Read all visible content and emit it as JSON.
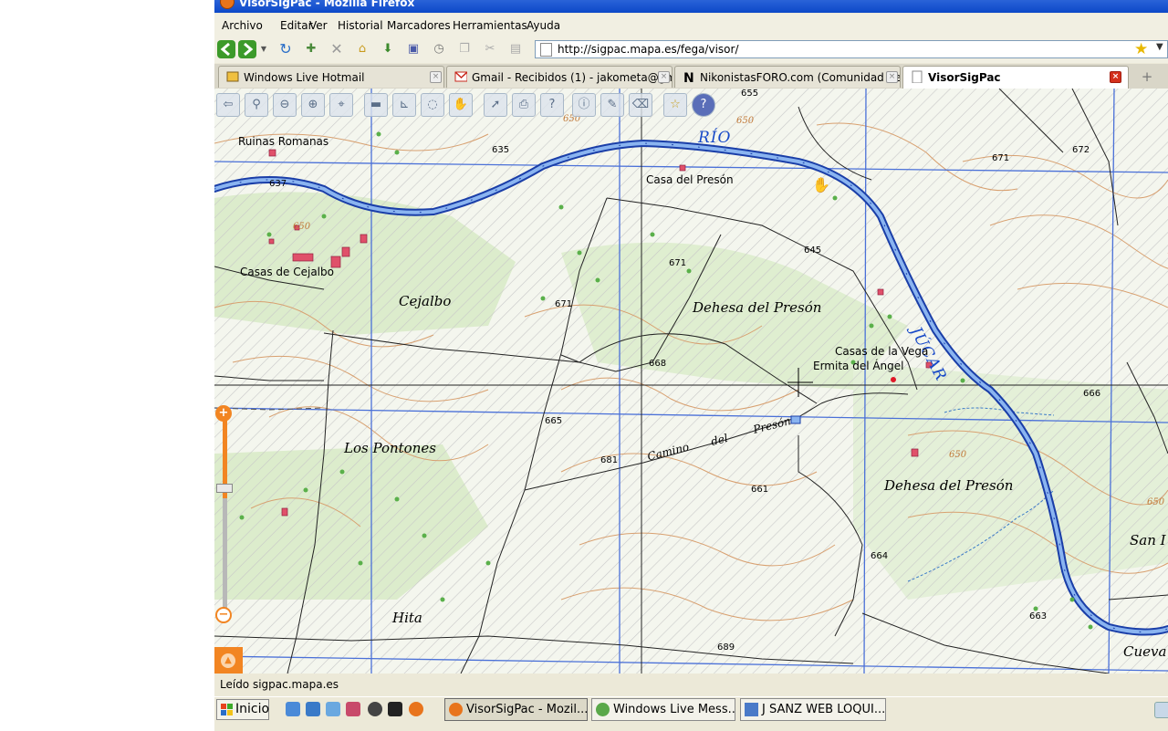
{
  "window": {
    "title": "VisorSigPac - Mozilla Firefox"
  },
  "menu": [
    "Archivo",
    "Editar",
    "Ver",
    "Historial",
    "Marcadores",
    "Herramientas",
    "Ayuda"
  ],
  "address": {
    "url": "http://sigpac.mapa.es/fega/visor/"
  },
  "tabs": [
    {
      "label": "Windows Live Hotmail",
      "active": false
    },
    {
      "label": "Gmail - Recibidos (1) - jakometa@gmail....",
      "active": false
    },
    {
      "label": "NikonistasFORO.com (Comunidad de us...",
      "active": false
    },
    {
      "label": "VisorSigPac",
      "active": true
    }
  ],
  "map": {
    "river_label_1": "RÍO",
    "river_label_2": "JÚCAR",
    "places": {
      "ruinas": "Ruinas Romanas",
      "casa_preson": "Casa del Presón",
      "casas_cejalbo": "Casas de Cejalbo",
      "cejalbo": "Cejalbo",
      "dehesa1": "Dehesa del Presón",
      "casas_vega": "Casas de la Vega",
      "ermita": "Ermita del Ángel",
      "pontones": "Los Pontones",
      "camino": "Camino",
      "del": "del",
      "preson": "Presón",
      "dehesa2": "Dehesa del Presón",
      "hita": "Hita",
      "san": "San I",
      "cueva": "Cueva"
    },
    "elevations": {
      "e655": "655",
      "e635": "635",
      "e637": "637",
      "e650a": "650",
      "e650b": "650",
      "e650c": "650",
      "e671a": "671",
      "e672": "672",
      "e645": "645",
      "e671b": "671",
      "e671c": "671",
      "e668": "668",
      "e665": "665",
      "e666": "666",
      "e681": "681",
      "e661": "661",
      "e650d": "650",
      "e650e": "650",
      "e664": "664",
      "e663": "663",
      "e689": "689"
    }
  },
  "status": {
    "text": "Leído sigpac.mapa.es"
  },
  "taskbar": {
    "start": "Inicio",
    "buttons": [
      {
        "label": "VisorSigPac - Mozil...",
        "active": true
      },
      {
        "label": "Windows Live Mess...",
        "active": false
      },
      {
        "label": "J SANZ WEB LOQUI...",
        "active": false
      }
    ]
  },
  "colors": {
    "titlebar": "#0c48c8",
    "river": "#1648c8",
    "zoom_accent": "#f28522",
    "map_bg": "#e9f2e0",
    "settlement": "#e0506a"
  },
  "icons": [
    "firefox-icon",
    "back-arrow-icon",
    "forward-arrow-icon",
    "dropdown-icon",
    "reload-icon",
    "new-bookmark-icon",
    "stop-icon",
    "home-icon",
    "download-icon",
    "page-icon",
    "history-icon",
    "copy-icon",
    "cut-icon",
    "paste-icon",
    "star-icon",
    "zoom-plus-icon",
    "zoom-minus-icon",
    "windows-flag-icon"
  ]
}
